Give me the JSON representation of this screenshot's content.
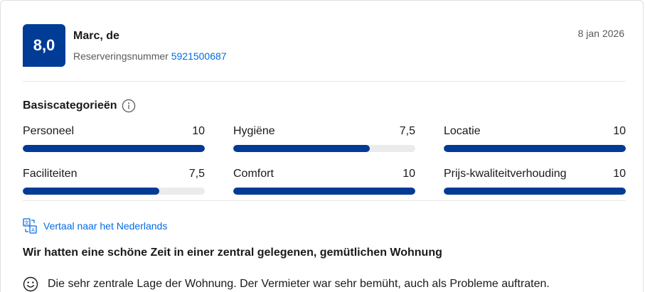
{
  "review": {
    "score": "8,0",
    "reviewer": "Marc, de",
    "reservation_label": "Reserveringsnummer",
    "reservation_number": "5921500687",
    "date": "8 jan 2026"
  },
  "categories_section": {
    "title": "Basiscategorieën",
    "info_icon": "info-icon",
    "items": [
      {
        "label": "Personeel",
        "value": "10",
        "fill": 1.0
      },
      {
        "label": "Hygiëne",
        "value": "7,5",
        "fill": 0.75
      },
      {
        "label": "Locatie",
        "value": "10",
        "fill": 1.0
      },
      {
        "label": "Faciliteiten",
        "value": "7,5",
        "fill": 0.75
      },
      {
        "label": "Comfort",
        "value": "10",
        "fill": 1.0
      },
      {
        "label": "Prijs-kwaliteitverhouding",
        "value": "10",
        "fill": 1.0
      }
    ]
  },
  "translate": {
    "icon": "translate-icon",
    "label": "Vertaal naar het Nederlands"
  },
  "content": {
    "title": "Wir hatten eine schöne Zeit in einer zentral gelegenen, gemütlichen Wohnung",
    "positive_icon": "smile-icon",
    "positive_text": "Die sehr zentrale Lage der Wohnung. Der Vermieter war sehr bemüht, auch als Probleme auftraten."
  },
  "colors": {
    "brand": "#003b95",
    "link": "#006ce4",
    "track": "#ebebeb"
  }
}
